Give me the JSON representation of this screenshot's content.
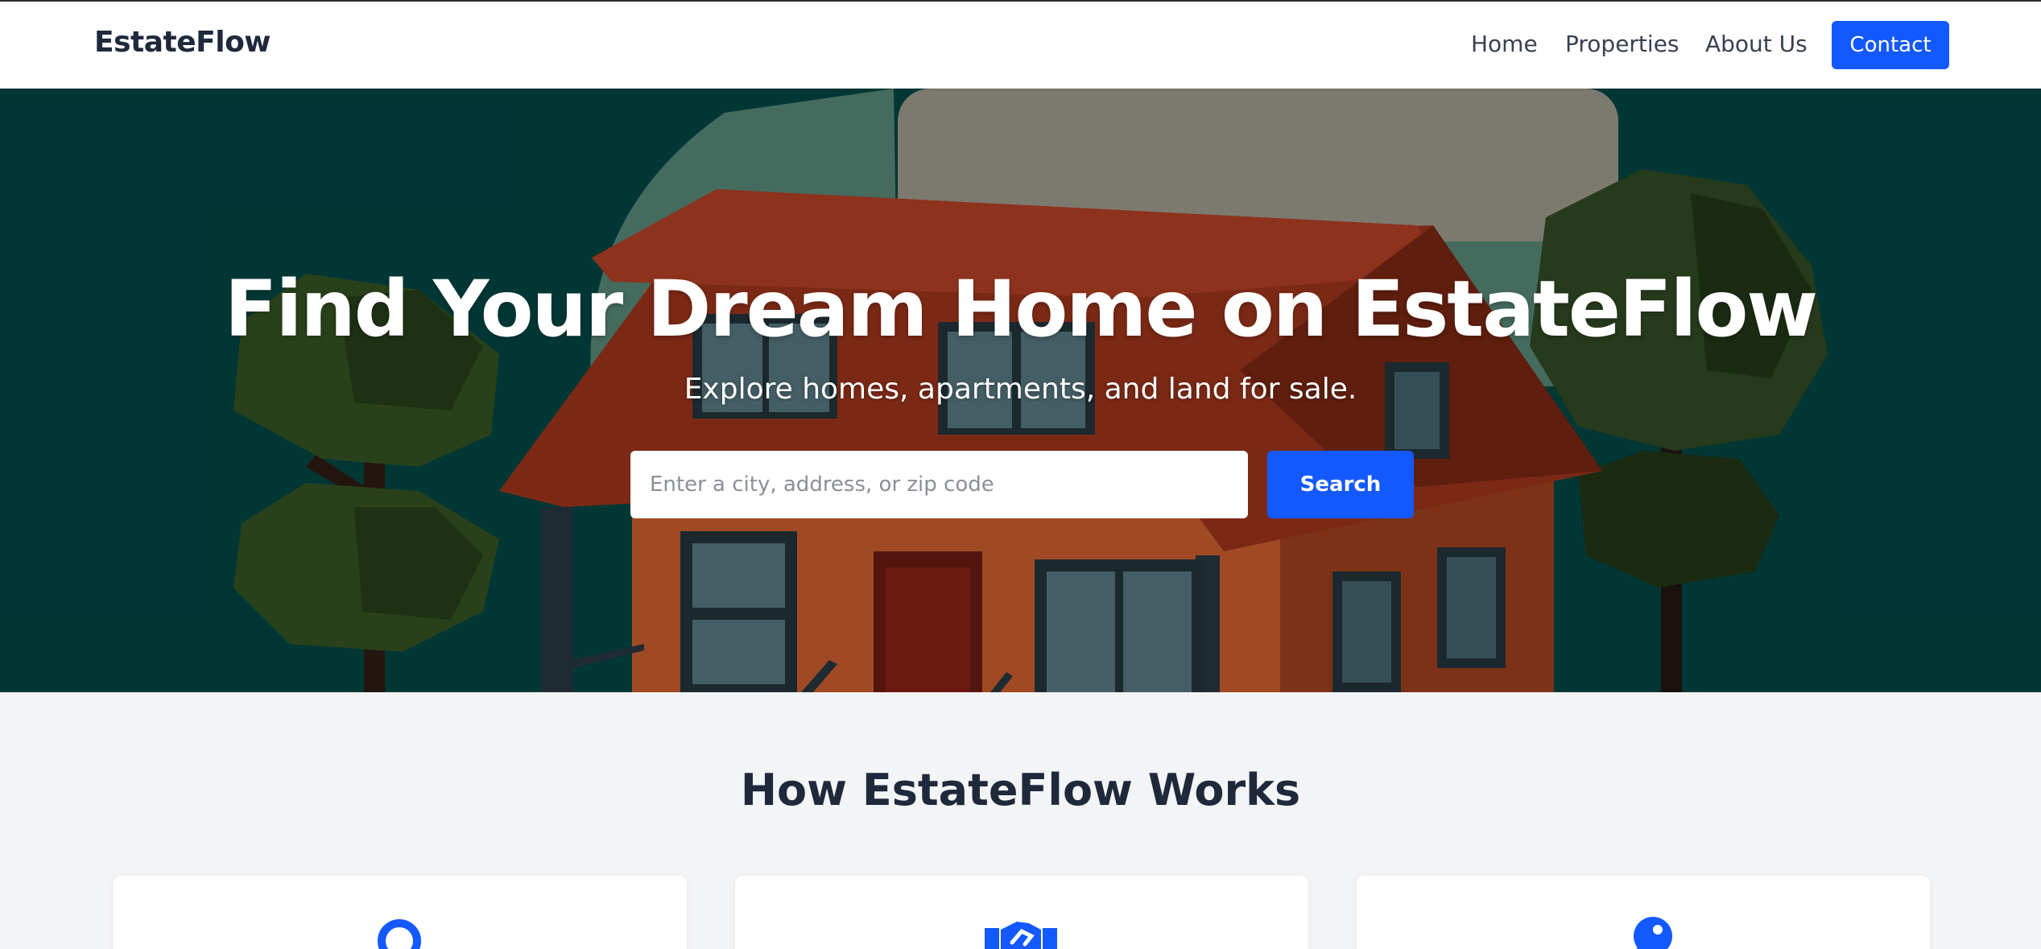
{
  "navbar": {
    "brand": "EstateFlow",
    "links": [
      {
        "label": "Home"
      },
      {
        "label": "Properties"
      },
      {
        "label": "About Us"
      }
    ],
    "contact_label": "Contact"
  },
  "hero": {
    "title": "Find Your Dream Home on EstateFlow",
    "subtitle": "Explore homes, apartments, and land for sale.",
    "search_placeholder": "Enter a city, address, or zip code",
    "search_value": "",
    "search_button": "Search"
  },
  "how": {
    "title": "How EstateFlow Works",
    "cards": [
      {
        "icon": "search-icon"
      },
      {
        "icon": "handshake-icon"
      },
      {
        "icon": "key-icon"
      }
    ]
  },
  "colors": {
    "accent": "#1459ff",
    "hero_bg": "#003f3d",
    "heading": "#1e293b",
    "page_bg": "#f3f4f6"
  }
}
